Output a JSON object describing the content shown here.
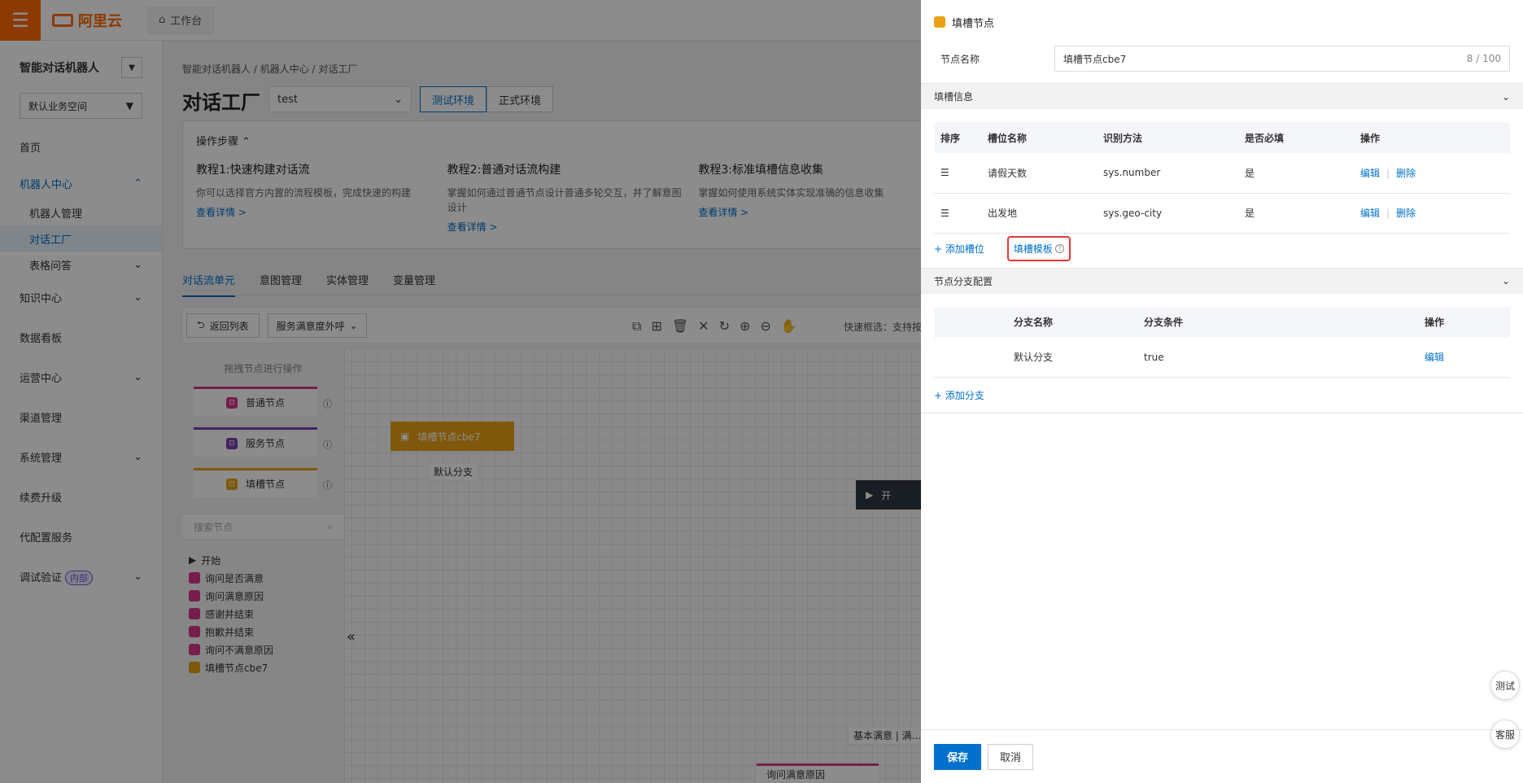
{
  "topbar": {
    "logo_text": "阿里云",
    "workbench": "工作台"
  },
  "sidebar": {
    "title": "智能对话机器人",
    "space": "默认业务空间",
    "items": [
      {
        "label": "首页"
      },
      {
        "label": "机器人中心"
      },
      {
        "label": "知识中心"
      },
      {
        "label": "数据看板"
      },
      {
        "label": "运营中心"
      },
      {
        "label": "渠道管理"
      },
      {
        "label": "系统管理"
      },
      {
        "label": "续费升级"
      },
      {
        "label": "代配置服务"
      },
      {
        "label": "调试验证",
        "badge": "内部"
      }
    ],
    "robot_sub": [
      "机器人管理",
      "对话工厂",
      "表格问答"
    ]
  },
  "main": {
    "breadcrumb": [
      "智能对话机器人",
      "机器人中心",
      "对话工厂"
    ],
    "title": "对话工厂",
    "env_select": "test",
    "env_buttons": [
      "测试环境",
      "正式环境"
    ],
    "steps": {
      "head": "操作步骤",
      "cols": [
        {
          "title": "教程1:快速构建对话流",
          "desc": "你可以选择官方内置的流程模板，完成快速的构建",
          "link": "查看详情 >"
        },
        {
          "title": "教程2:普通对话流构建",
          "desc": "掌握如何通过普通节点设计普通多轮交互，并了解意图设计",
          "link": "查看详情 >"
        },
        {
          "title": "教程3:标准填槽信息收集",
          "desc": "掌握如何使用系统实体实现准确的信息收集",
          "link": "查看详情 >"
        }
      ]
    },
    "tabs": [
      "对话流单元",
      "意图管理",
      "实体管理",
      "变量管理"
    ],
    "toolbar": {
      "back": "返回列表",
      "flow": "服务满意度外呼",
      "hint": "快速框选：支持按住s"
    },
    "palette": {
      "hint": "拖拽节点进行操作",
      "nodes": [
        "普通节点",
        "服务节点",
        "填槽节点"
      ],
      "search_placeholder": "搜索节点",
      "tree": [
        "开始",
        "询问是否满意",
        "询问满意原因",
        "感谢并结束",
        "抱歉并结束",
        "询问不满意原因",
        "填槽节点cbe7"
      ]
    },
    "canvas": {
      "slot_node": "填槽节点cbe7",
      "default_branch": "默认分支",
      "start_node": "开",
      "bottom_label": "基本满意 | 满...",
      "bottom_node": "询问满意原因"
    }
  },
  "panel": {
    "title": "填槽节点",
    "name_label": "节点名称",
    "name_value": "填槽节点cbe7",
    "name_count": "8 / 100",
    "slot_section": "填槽信息",
    "slot_headers": [
      "排序",
      "槽位名称",
      "识别方法",
      "是否必填",
      "操作"
    ],
    "slot_rows": [
      {
        "name": "请假天数",
        "method": "sys.number",
        "required": "是"
      },
      {
        "name": "出发地",
        "method": "sys.geo-city",
        "required": "是"
      }
    ],
    "edit": "编辑",
    "delete": "删除",
    "add_slot": "+ 添加槽位",
    "slot_template": "填槽模板",
    "branch_section": "节点分支配置",
    "branch_headers": [
      "分支名称",
      "分支条件",
      "操作"
    ],
    "branch_rows": [
      {
        "name": "默认分支",
        "condition": "true"
      }
    ],
    "add_branch": "+ 添加分支",
    "save": "保存",
    "cancel": "取消",
    "float_test": "测试",
    "float_service": "客服"
  }
}
